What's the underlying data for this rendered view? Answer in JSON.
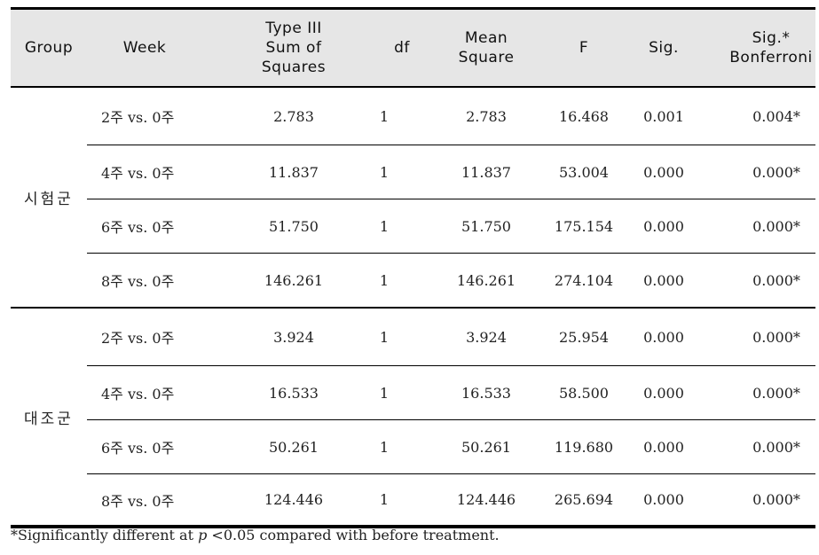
{
  "table": {
    "headers": {
      "group": "Group",
      "week": "Week",
      "sum_of_squares": [
        "Type III",
        "Sum of",
        "Squares"
      ],
      "df": "df",
      "mean_square": [
        "Mean",
        "Square"
      ],
      "f": "F",
      "sig": "Sig.",
      "sig_bonferroni": [
        "Sig.*",
        "Bonferroni"
      ]
    },
    "groups": [
      {
        "label": "시험군",
        "rows": [
          {
            "week": "2주  vs. 0주",
            "ss": "2.783",
            "df": "1",
            "ms": "2.783",
            "f": "16.468",
            "sig": "0.001",
            "bon": "0.004*"
          },
          {
            "week": "4주  vs. 0주",
            "ss": "11.837",
            "df": "1",
            "ms": "11.837",
            "f": "53.004",
            "sig": "0.000",
            "bon": "0.000*"
          },
          {
            "week": "6주  vs. 0주",
            "ss": "51.750",
            "df": "1",
            "ms": "51.750",
            "f": "175.154",
            "sig": "0.000",
            "bon": "0.000*"
          },
          {
            "week": "8주  vs. 0주",
            "ss": "146.261",
            "df": "1",
            "ms": "146.261",
            "f": "274.104",
            "sig": "0.000",
            "bon": "0.000*"
          }
        ]
      },
      {
        "label": "대조군",
        "rows": [
          {
            "week": "2주  vs. 0주",
            "ss": "3.924",
            "df": "1",
            "ms": "3.924",
            "f": "25.954",
            "sig": "0.000",
            "bon": "0.000*"
          },
          {
            "week": "4주  vs. 0주",
            "ss": "16.533",
            "df": "1",
            "ms": "16.533",
            "f": "58.500",
            "sig": "0.000",
            "bon": "0.000*"
          },
          {
            "week": "6주  vs. 0주",
            "ss": "50.261",
            "df": "1",
            "ms": "50.261",
            "f": "119.680",
            "sig": "0.000",
            "bon": "0.000*"
          },
          {
            "week": "8주  vs. 0주",
            "ss": "124.446",
            "df": "1",
            "ms": "124.446",
            "f": "265.694",
            "sig": "0.000",
            "bon": "0.000*"
          }
        ]
      }
    ]
  },
  "footnote": {
    "prefix": "*Significantly different at ",
    "p": "p",
    "suffix": " <0.05 compared with before treatment."
  }
}
